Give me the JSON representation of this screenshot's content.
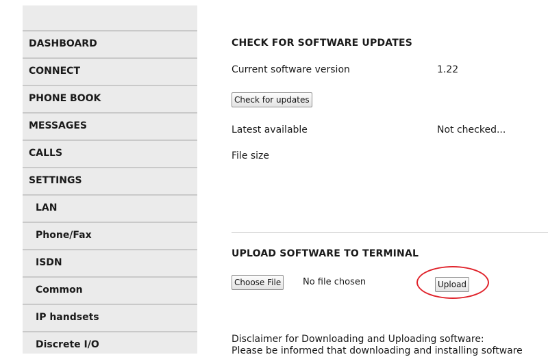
{
  "sidebar": {
    "items": [
      {
        "label": "DASHBOARD"
      },
      {
        "label": "CONNECT"
      },
      {
        "label": "PHONE BOOK"
      },
      {
        "label": "MESSAGES"
      },
      {
        "label": "CALLS"
      },
      {
        "label": "SETTINGS"
      },
      {
        "label": "LAN"
      },
      {
        "label": "Phone/Fax"
      },
      {
        "label": "ISDN"
      },
      {
        "label": "Common"
      },
      {
        "label": "IP handsets"
      },
      {
        "label": "Discrete I/O"
      }
    ]
  },
  "check_updates": {
    "heading": "CHECK FOR SOFTWARE UPDATES",
    "current_version_label": "Current software version",
    "current_version_value": "1.22",
    "check_button": "Check for updates",
    "latest_label": "Latest available",
    "latest_value": "Not checked...",
    "file_size_label": "File size"
  },
  "upload": {
    "heading": "UPLOAD SOFTWARE TO TERMINAL",
    "choose_file_button": "Choose File",
    "no_file_text": "No file chosen",
    "upload_button": "Upload",
    "disclaimer_line1": "Disclaimer for Downloading and Uploading software:",
    "disclaimer_line2": "Please be informed that downloading and installing software"
  },
  "annotation_color": "#e0232b"
}
